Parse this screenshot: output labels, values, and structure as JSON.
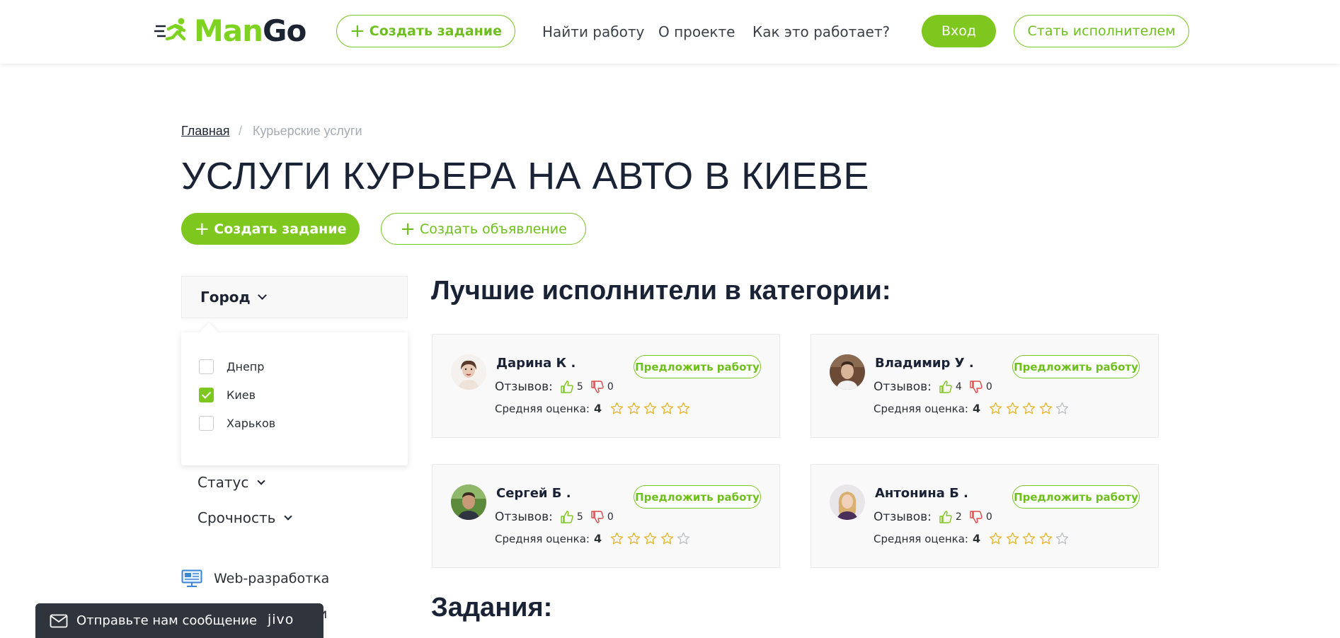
{
  "header": {
    "logo_man": "Man",
    "logo_go": "Go",
    "create_task": "Создать задание",
    "nav": [
      "Найти работу",
      "О проекте",
      "Как это работает?"
    ],
    "login": "Вход",
    "become_executor": "Стать исполнителем"
  },
  "breadcrumb": {
    "home": "Главная",
    "separator": "/",
    "current": "Курьерские услуги"
  },
  "page_title": "УСЛУГИ КУРЬЕРА НА АВТО В КИЕВЕ",
  "actions": {
    "create_task": "Создать задание",
    "create_ad": "Создать объявление"
  },
  "filters": {
    "city_label": "Город",
    "cities": [
      {
        "name": "Днепр",
        "checked": false
      },
      {
        "name": "Киев",
        "checked": true
      },
      {
        "name": "Харьков",
        "checked": false
      }
    ],
    "status_label": "Статус",
    "urgency_label": "Срочность"
  },
  "categories": {
    "web": "Web-разработка",
    "partial": "ги"
  },
  "executors_title": "Лучшие исполнители в категории:",
  "executors": [
    {
      "name": "Дарина К .",
      "reviews_label": "Отзывов:",
      "likes": "5",
      "dislikes": "0",
      "rating_label": "Средняя оценка:",
      "rating": "4",
      "offer": "Предложить работу"
    },
    {
      "name": "Владимир У .",
      "reviews_label": "Отзывов:",
      "likes": "4",
      "dislikes": "0",
      "rating_label": "Средняя оценка:",
      "rating": "4",
      "offer": "Предложить работу"
    },
    {
      "name": "Сергей Б .",
      "reviews_label": "Отзывов:",
      "likes": "5",
      "dislikes": "0",
      "rating_label": "Средняя оценка:",
      "rating": "4",
      "offer": "Предложить работу"
    },
    {
      "name": "Антонина Б .",
      "reviews_label": "Отзывов:",
      "likes": "2",
      "dislikes": "0",
      "rating_label": "Средняя оценка:",
      "rating": "4",
      "offer": "Предложить работу"
    }
  ],
  "tasks_title": "Задания:",
  "chat": {
    "message": "Отправьте нам сообщение",
    "brand": "jivo"
  },
  "colors": {
    "accent": "#7ec71e",
    "dark": "#1c2331",
    "dislike": "#e04848"
  }
}
